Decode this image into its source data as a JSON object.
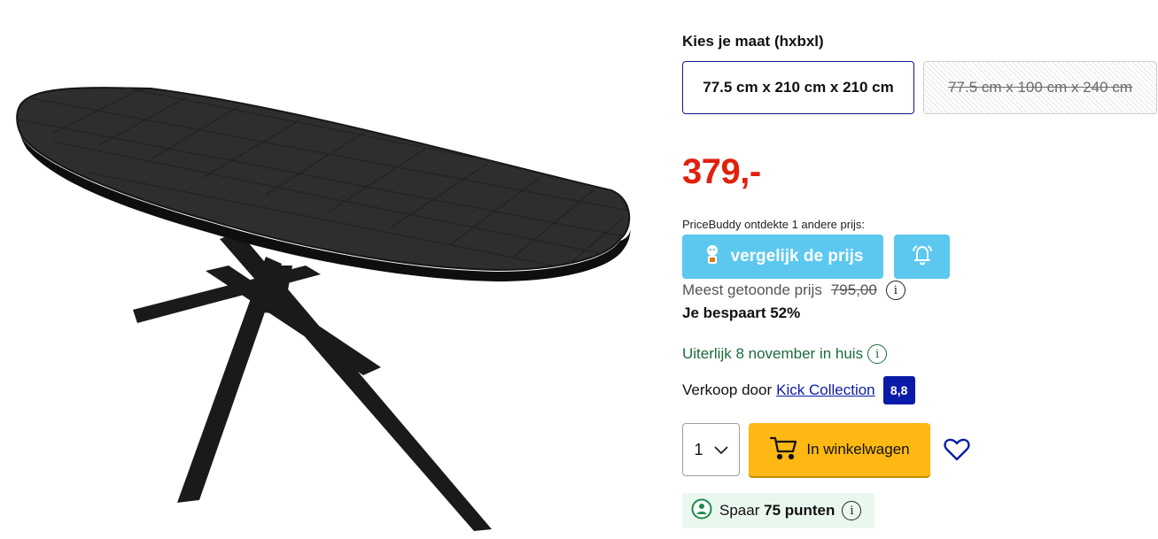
{
  "size_selector": {
    "title": "Kies je maat (hxbxl)",
    "options": [
      {
        "label": "77.5 cm x 210 cm x 210 cm",
        "state": "selected"
      },
      {
        "label": "77.5 cm x 100 cm x 240 cm",
        "state": "unavailable"
      }
    ]
  },
  "price": {
    "amount": "379,-"
  },
  "pricebuddy": {
    "intro": "PriceBuddy ontdekte 1 andere prijs:",
    "compare_label": "vergelijk de prijs",
    "compare_icon": "pricebuddy-mascot-icon",
    "alert_icon": "bell-icon"
  },
  "reference_price": {
    "label": "Meest getoonde prijs",
    "old_price": "795,00",
    "info_icon": "i"
  },
  "saving": {
    "text": "Je bespaart 52%"
  },
  "delivery": {
    "text": "Uiterlijk 8 november in huis",
    "info_icon": "i"
  },
  "seller": {
    "prefix": "Verkoop door",
    "name": "Kick Collection",
    "score": "8,8"
  },
  "purchase": {
    "quantity": "1",
    "cart_label": "In winkelwagen"
  },
  "points": {
    "prefix": "Spaar",
    "amount": "75 punten",
    "info_icon": "i"
  },
  "colors": {
    "price": "#e0210d",
    "pricebuddy": "#5cc8f0",
    "brand_blue": "#0a1aa8",
    "cart": "#fdb813",
    "delivery_green": "#1b6b3a"
  }
}
